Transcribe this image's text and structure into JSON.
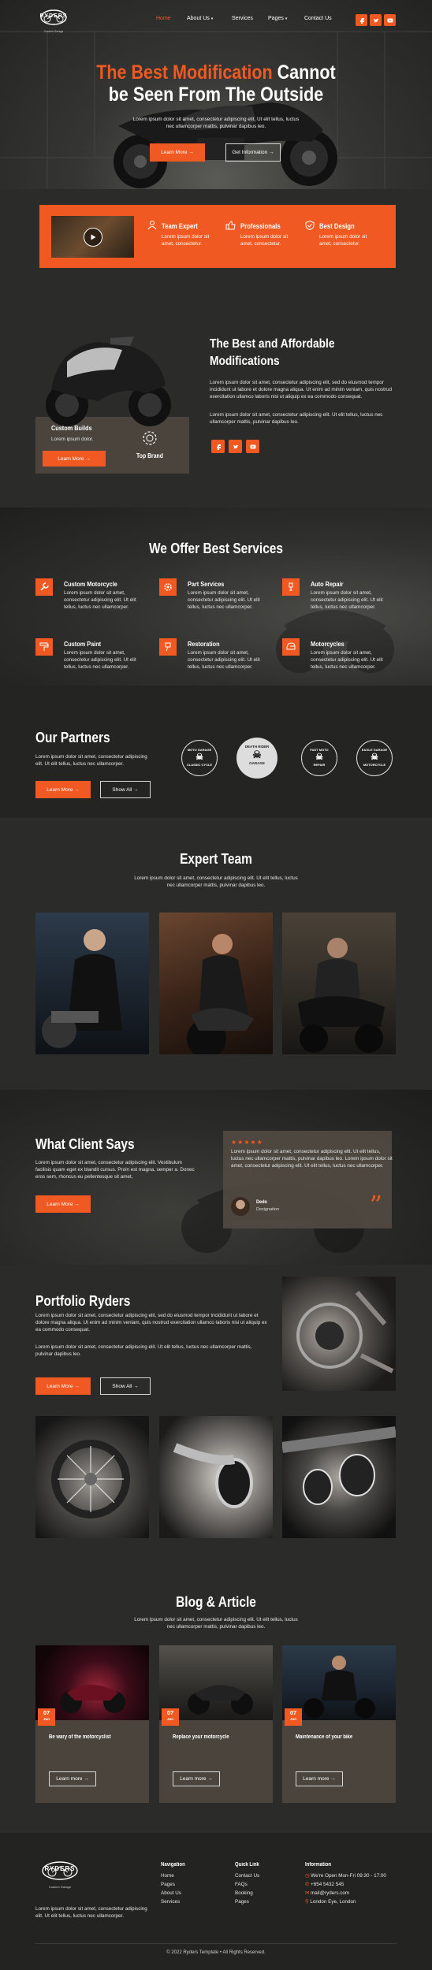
{
  "brand": {
    "name": "RYDERS",
    "tag": "Custom Garage"
  },
  "nav": {
    "home": "Home",
    "about": "About Us",
    "services": "Services",
    "pages": "Pages",
    "contact": "Contact Us"
  },
  "hero": {
    "title_orange": "The Best Modification",
    "title_rest1": "Cannot",
    "title_rest2": "be Seen From The Outside",
    "desc1": "Lorem ipsum dolor sit amet, consectetur adipiscing elit. Ut elit tellus, luctus",
    "desc2": "nec ullamcorper mattis, pulvinar dapibus leo.",
    "learn": "Learn More",
    "info": "Get Information"
  },
  "features": {
    "items": [
      {
        "title": "Team Expert",
        "text1": "Lorem ipsum dolor sit",
        "text2": "amet, consectetur."
      },
      {
        "title": "Professionals",
        "text1": "Lorem ipsum dolor sit",
        "text2": "amet, consectetur."
      },
      {
        "title": "Best Design",
        "text1": "Lorem ipsum dolor sit",
        "text2": "amet, consectetur."
      }
    ]
  },
  "about": {
    "title1": "The Best and Affordable",
    "title2": "Modifications",
    "p1": "Lorem ipsum dolor sit amet, consectetur adipiscing elit, sed do eiusmod tempor incididunt ut labore et dolore magna aliqua. Ut enim ad minim veniam, quis nostrud exercitation ullamco laboris nisi ut aliquip ex ea commodo consequat.",
    "p2": "Lorem ipsum dolor sit amet, consectetur adipiscing elit. Ut elit tellus, luctus nec ullamcorper mattis, pulvinar dapibus leo.",
    "card_title": "Custom Builds",
    "card_text": "Lorem ipsum dolor.",
    "card_btn": "Learn More",
    "badge": "Top Brand"
  },
  "services": {
    "title": "We Offer Best Services",
    "items": [
      {
        "title": "Custom Motorcycle",
        "t1": "Lorem ipsum dolor sit amet,",
        "t2": "consectetur adipiscing elit. Ut elit",
        "t3": "tellus, luctus nec ullamcorper."
      },
      {
        "title": "Part Services",
        "t1": "Lorem ipsum dolor sit amet,",
        "t2": "consectetur adipiscing elit. Ut elit",
        "t3": "tellus, luctus nec ullamcorper."
      },
      {
        "title": "Auto Repair",
        "t1": "Lorem ipsum dolor sit amet,",
        "t2": "consectetur adipiscing elit. Ut elit",
        "t3": "tellus, luctus nec ullamcorper."
      },
      {
        "title": "Custom Paint",
        "t1": "Lorem ipsum dolor sit amet,",
        "t2": "consectetur adipiscing elit. Ut elit",
        "t3": "tellus, luctus nec ullamcorper."
      },
      {
        "title": "Restoration",
        "t1": "Lorem ipsum dolor sit amet,",
        "t2": "consectetur adipiscing elit. Ut elit",
        "t3": "tellus, luctus nec ullamcorper."
      },
      {
        "title": "Motorcycles",
        "t1": "Lorem ipsum dolor sit amet,",
        "t2": "consectetur adipiscing elit. Ut elit",
        "t3": "tellus, luctus nec ullamcorper."
      }
    ]
  },
  "partners": {
    "title": "Our Partners",
    "d1": "Lorem ipsum dolor sit amet, consectetur adipiscing",
    "d2": "elit. Ut elit tellus, luctus nec ullamcorper.",
    "learn": "Learn More",
    "show": "Show All",
    "logos": [
      {
        "top": "MOTO GARAGE",
        "bot": "CLASSIC CYCLE"
      },
      {
        "top": "DEATH RIDER",
        "bot": "GARAGE"
      },
      {
        "top": "FAST MOTO",
        "bot": "REPAIR"
      },
      {
        "top": "EAGLE GARAGE",
        "bot": "MOTORCYCLE"
      }
    ]
  },
  "team": {
    "title": "Expert Team",
    "d1": "Lorem ipsum dolor sit amet, consectetur adipiscing elit. Ut elit tellus, luctus",
    "d2": "nec ullamcorper mattis, pulvinar dapibus leo."
  },
  "testimonial": {
    "title": "What Client Says",
    "d1": "Lorem ipsum dolor sit amet, consectetur adipiscing elit. Vestibulum",
    "d2": "facilisis quam eget ex blandit cursus. Proin est magna, semper a. Donec",
    "d3": "eros sem, rhoncus eu pellentesque sit amet,",
    "learn": "Learn More",
    "stars": "★★★★★",
    "q1": "Lorem ipsum dolor sit amet, consectetur adipiscing elit. Ut elit tellus,",
    "q2": "luctus nec ullamcorper mattis, pulvinar dapibus leo. Lorem ipsum dolor sit",
    "q3": "amet, consectetur adipiscing elit. Ut elit tellus, luctus nec ullamcorper.",
    "name": "Dedo",
    "role": "Designation"
  },
  "portfolio": {
    "title": "Portfolio Ryders",
    "p1": "Lorem ipsum dolor sit amet, consectetur adipiscing elit, sed do eiusmod tempor incididunt ut labore et dolore magna aliqua. Ut enim ad minim veniam, quis nostrud exercitation ullamco laboris nisi ut aliquip ex ea commodo consequat.",
    "p2": "Lorem ipsum dolor sit amet, consectetur adipiscing elit. Ut elit tellus, luctus nec ullamcorper mattis, pulvinar dapibus leo.",
    "learn": "Learn More",
    "show": "Show All"
  },
  "blog": {
    "title": "Blog & Article",
    "d1": "Lorem ipsum dolor sit amet, consectetur adipiscing elit. Ut elit tellus, luctus",
    "d2": "nec ullamcorper mattis, pulvinar dapibus leo.",
    "posts": [
      {
        "day": "07",
        "month": "Jun",
        "title": "Be wary of the motorcyclist",
        "btn": "Learn more"
      },
      {
        "day": "07",
        "month": "Jun",
        "title": "Replace your motorcycle",
        "btn": "Learn more"
      },
      {
        "day": "07",
        "month": "Jun",
        "title": "Maintenance of your bike",
        "btn": "Learn more"
      }
    ]
  },
  "footer": {
    "about1": "Lorem ipsum dolor sit amet, consectetur adipiscing",
    "about2": "elit. Ut elit tellus, luctus nec ullamcorper.",
    "nav_title": "Navigation",
    "nav": [
      "Home",
      "Pages",
      "About Us",
      "Services"
    ],
    "quick_title": "Quick Link",
    "quick": [
      "Contact Us",
      "FAQs",
      "Booking",
      "Pages"
    ],
    "info_title": "Information",
    "info": [
      "We're Open Mon-Fri 09:30 - 17:00",
      "+654 5432 545",
      "mail@ryders.com",
      "London Eye, London"
    ],
    "copy": "© 2022 Ryders Template • All Rights Reserved."
  },
  "colors": {
    "accent": "#f05a22",
    "bg": "#2b2b29"
  }
}
